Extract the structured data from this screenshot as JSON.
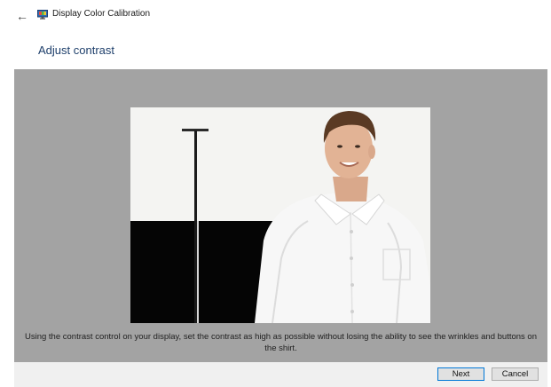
{
  "window": {
    "title": "Display Color Calibration",
    "back_icon": "back-arrow-icon",
    "app_icon": "monitor-icon"
  },
  "page": {
    "heading": "Adjust contrast",
    "instruction": "Using the contrast control on your display, set the contrast as high as possible without losing the ability to see the wrinkles and buttons on the shirt."
  },
  "buttons": {
    "next_label": "Next",
    "cancel_label": "Cancel"
  },
  "colors": {
    "content_background": "#a3a3a3",
    "heading": "#1e3f6b",
    "default_button_border": "#0078d7"
  }
}
